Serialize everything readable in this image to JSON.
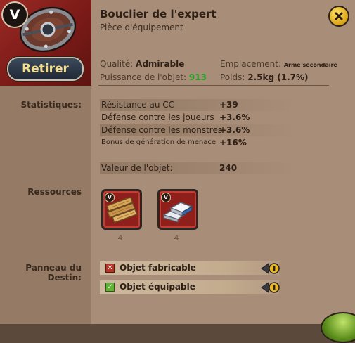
{
  "item": {
    "name": "Bouclier de l'expert",
    "type": "Pièce d'équipement",
    "tier": "V",
    "remove_label": "Retirer"
  },
  "info": {
    "quality_label": "Qualité:",
    "quality_value": "Admirable",
    "power_label": "Puissance de l'objet:",
    "power_value": "913",
    "slot_label": "Emplacement:",
    "slot_value": "Arme secondaire",
    "weight_label": "Poids:",
    "weight_value": "2.5kg (1.7%)"
  },
  "stats": {
    "label": "Statistiques:",
    "rows": [
      {
        "name": "Résistance au CC",
        "value": "+39"
      },
      {
        "name": "Défense contre les joueurs",
        "value": "+3.6%"
      },
      {
        "name": "Défense contre les monstres",
        "value": "+3.6%"
      },
      {
        "name": "Bonus de génération de menace",
        "value": "+16%"
      }
    ],
    "item_value_label": "Valeur de l'objet:",
    "item_value": "240"
  },
  "resources": {
    "label": "Ressources",
    "items": [
      {
        "name": "planks",
        "tier": "V",
        "count": "4",
        "icon": "wood-planks-icon"
      },
      {
        "name": "metal-bars",
        "tier": "V",
        "count": "4",
        "icon": "metal-bar-icon"
      }
    ]
  },
  "destiny": {
    "label_line1": "Panneau du",
    "label_line2": "Destin:",
    "rows": [
      {
        "text": "Objet fabricable",
        "checked": false
      },
      {
        "text": "Objet équipable",
        "checked": true
      }
    ]
  },
  "colors": {
    "power": "#28a028",
    "hero_bg": "#9a2a24",
    "panel": "#a88e78",
    "button_text": "#f3dc8a"
  }
}
